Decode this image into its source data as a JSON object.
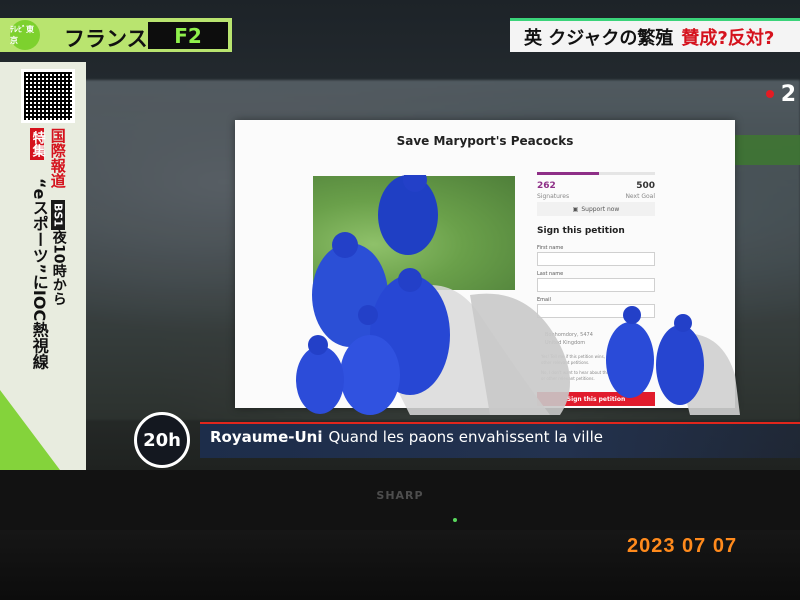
{
  "channel": {
    "logo_text": "ﾃﾚﾋﾞ東京",
    "country": "フランス",
    "name": "F2"
  },
  "headline": {
    "main": "英 クジャクの繁殖",
    "question": "賛成?反対?"
  },
  "side_strip": {
    "tag": "特集",
    "line1": "国際報道",
    "bs": "BS1",
    "time": "夜10時から",
    "line2": "“eスポーツ”にIOC熱視線"
  },
  "corner_logo": "2",
  "petition": {
    "title": "Save Maryport's Peacocks",
    "signatures": "262",
    "signatures_label": "Signatures",
    "goal": "500",
    "goal_label": "Next Goal",
    "progress_fraction": 0.524,
    "support_label": "Support now",
    "sign_heading": "Sign this petition",
    "first_name_label": "First name",
    "last_name_label": "Last name",
    "email_label": "Email",
    "location_line1": "Bonhomdory, 5474",
    "location_line2": "United Kingdom",
    "checkbox_yes": "Yes! Tell me if this petition wins, and how I can help other relevant petitions.",
    "checkbox_no": "No, I don't want to hear about this petition's progress or other relevant petitions.",
    "sign_button": "Sign this petition"
  },
  "lower_third": {
    "badge": "20h",
    "bold": "Royaume-Uni",
    "text": "Quand les paons envahissent la ville"
  },
  "tv_brand": "SHARP",
  "datestamp": "2023  07  07",
  "colors": {
    "channel_bar": "#b9e46f",
    "headline_red": "#d5121d",
    "petition_purple": "#8e2f87",
    "sign_button_red": "#e11b2c",
    "lower_third_blue": "#1d2d4a",
    "datestamp_orange": "#ff8a1c"
  }
}
